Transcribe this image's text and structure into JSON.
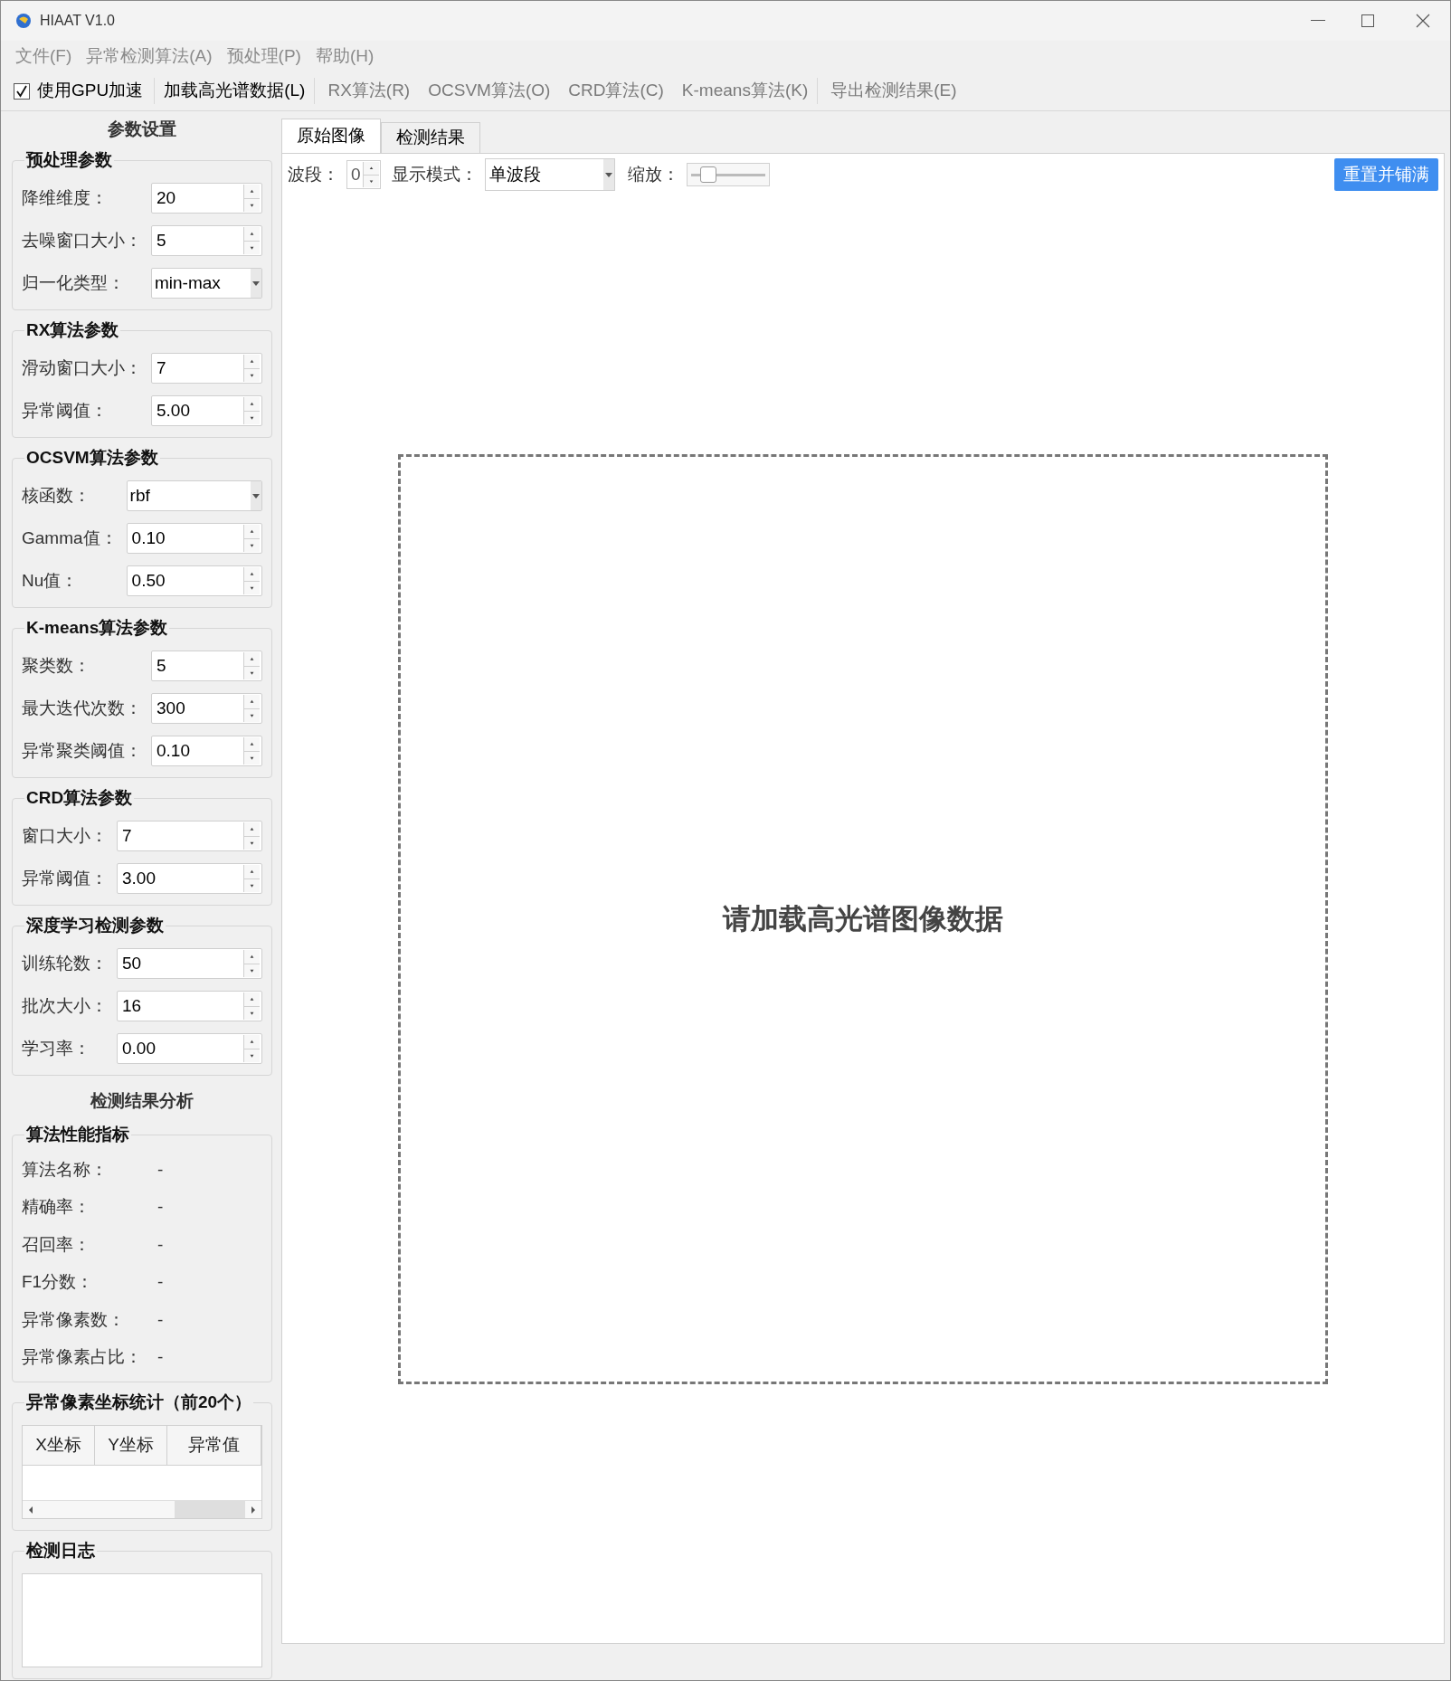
{
  "window": {
    "title": "HIAAT V1.0"
  },
  "menu": [
    "文件(F)",
    "异常检测算法(A)",
    "预处理(P)",
    "帮助(H)"
  ],
  "toolbar": {
    "gpu": {
      "label": "使用GPU加速",
      "checked": true
    },
    "actions": [
      {
        "label": "加载高光谱数据(L)",
        "disabled": false
      },
      {
        "label": "RX算法(R)",
        "disabled": true
      },
      {
        "label": "OCSVM算法(O)",
        "disabled": true
      },
      {
        "label": "CRD算法(C)",
        "disabled": true
      },
      {
        "label": "K-means算法(K)",
        "disabled": true
      },
      {
        "label": "导出检测结果(E)",
        "disabled": true
      }
    ]
  },
  "params": {
    "title": "参数设置",
    "groups": [
      {
        "title": "预处理参数",
        "fields": [
          {
            "kind": "spin",
            "label": "降维维度：",
            "value": "20"
          },
          {
            "kind": "spin",
            "label": "去噪窗口大小：",
            "value": "5"
          },
          {
            "kind": "combo",
            "label": "归一化类型：",
            "value": "min-max"
          }
        ]
      },
      {
        "title": "RX算法参数",
        "fields": [
          {
            "kind": "spin",
            "label": "滑动窗口大小：",
            "value": "7"
          },
          {
            "kind": "spin",
            "label": "异常阈值：",
            "value": "5.00"
          }
        ]
      },
      {
        "title": "OCSVM算法参数",
        "fields": [
          {
            "kind": "combo",
            "label": "核函数：",
            "value": "rbf"
          },
          {
            "kind": "spin",
            "label": "Gamma值：",
            "value": "0.10"
          },
          {
            "kind": "spin",
            "label": "Nu值：",
            "value": "0.50"
          }
        ]
      },
      {
        "title": "K-means算法参数",
        "fields": [
          {
            "kind": "spin",
            "label": "聚类数：",
            "value": "5"
          },
          {
            "kind": "spin",
            "label": "最大迭代次数：",
            "value": "300"
          },
          {
            "kind": "spin",
            "label": "异常聚类阈值：",
            "value": "0.10"
          }
        ]
      },
      {
        "title": "CRD算法参数",
        "fields": [
          {
            "kind": "spin",
            "label": "窗口大小：",
            "value": "7"
          },
          {
            "kind": "spin",
            "label": "异常阈值：",
            "value": "3.00"
          }
        ]
      },
      {
        "title": "深度学习检测参数",
        "fields": [
          {
            "kind": "spin",
            "label": "训练轮数：",
            "value": "50"
          },
          {
            "kind": "spin",
            "label": "批次大小：",
            "value": "16"
          },
          {
            "kind": "spin",
            "label": "学习率：",
            "value": "0.00"
          }
        ]
      }
    ]
  },
  "analysis": {
    "title": "检测结果分析",
    "metrics": {
      "title": "算法性能指标",
      "rows": [
        {
          "label": "算法名称：",
          "value": "-"
        },
        {
          "label": "精确率：",
          "value": "-"
        },
        {
          "label": "召回率：",
          "value": "-"
        },
        {
          "label": "F1分数：",
          "value": "-"
        },
        {
          "label": "异常像素数：",
          "value": "-"
        },
        {
          "label": "异常像素占比：",
          "value": "-"
        }
      ]
    },
    "coords": {
      "title": "异常像素坐标统计（前20个）",
      "columns": [
        "X坐标",
        "Y坐标",
        "异常值"
      ]
    },
    "log": {
      "title": "检测日志"
    }
  },
  "tabs": [
    {
      "label": "原始图像",
      "selected": true
    },
    {
      "label": "检测结果",
      "selected": false
    }
  ],
  "view_controls": {
    "band": {
      "label": "波段：",
      "value": "0"
    },
    "mode": {
      "label": "显示模式：",
      "value": "单波段"
    },
    "zoom": {
      "label": "缩放：",
      "level": 0.2
    },
    "reset_button": "重置并铺满"
  },
  "placeholder_text": "请加载高光谱图像数据"
}
